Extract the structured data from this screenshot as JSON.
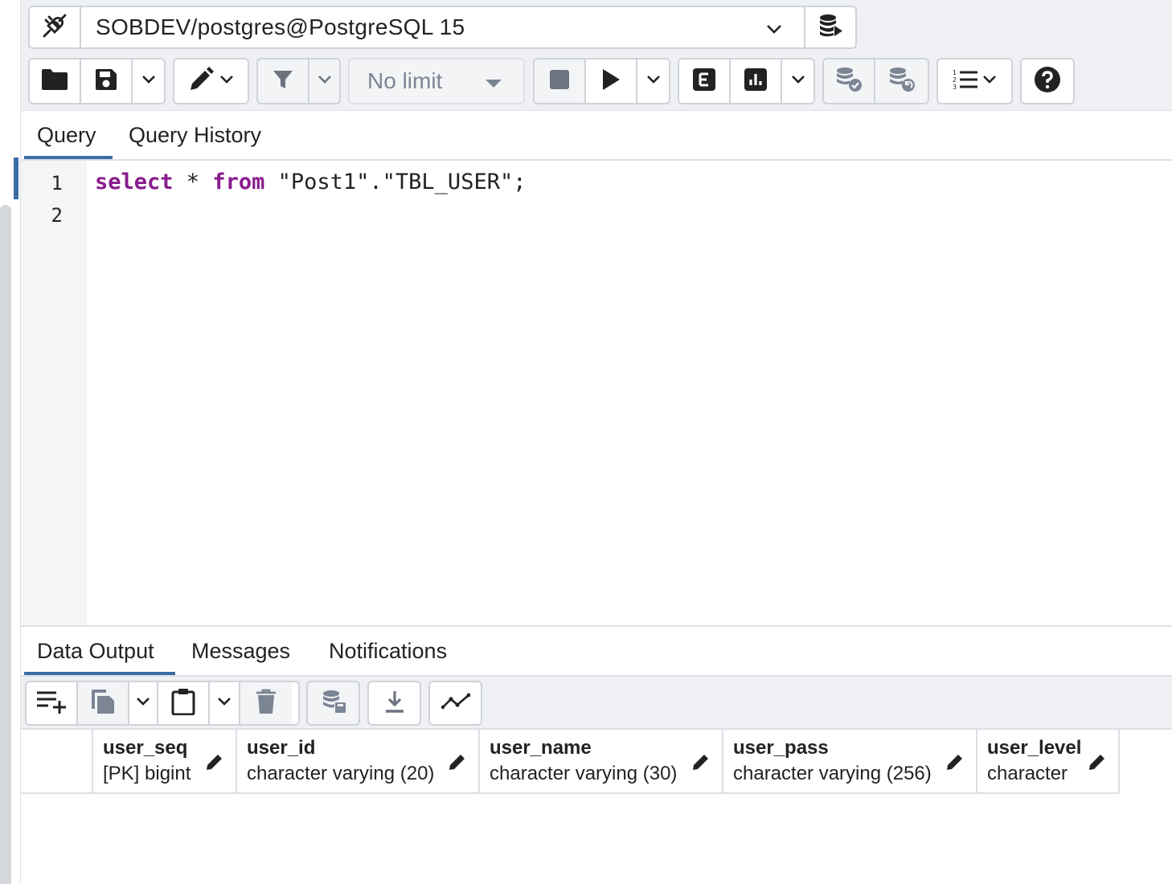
{
  "connection": {
    "label": "SOBDEV/postgres@PostgreSQL 15"
  },
  "toolbar": {
    "limit_label": "No limit"
  },
  "query_tabs": [
    {
      "label": "Query",
      "active": true
    },
    {
      "label": "Query History",
      "active": false
    }
  ],
  "editor": {
    "line_numbers": [
      "1",
      "2"
    ],
    "line1": {
      "kw_select": "select",
      "star": " * ",
      "kw_from": "from",
      "rest": " \"Post1\".\"TBL_USER\";"
    }
  },
  "output_tabs": [
    {
      "label": "Data Output",
      "active": true
    },
    {
      "label": "Messages",
      "active": false
    },
    {
      "label": "Notifications",
      "active": false
    }
  ],
  "grid": {
    "columns": [
      {
        "name": "user_seq",
        "type": "[PK] bigint"
      },
      {
        "name": "user_id",
        "type": "character varying (20)"
      },
      {
        "name": "user_name",
        "type": "character varying (30)"
      },
      {
        "name": "user_pass",
        "type": "character varying (256)"
      },
      {
        "name": "user_level",
        "type": "character"
      }
    ]
  },
  "colors": {
    "accent": "#3a6ea5",
    "keyword": "#8a1b8e",
    "toolbar_bg": "#eef0f3",
    "border": "#cfd3d9"
  },
  "icons": {
    "connection": "plug-disconnected-icon",
    "connection_action": "database-play-icon",
    "file": [
      "folder-open-icon",
      "save-icon",
      "chevron-down-icon"
    ],
    "edit": [
      "pencil-icon",
      "chevron-down-icon"
    ],
    "filter": [
      "filter-icon",
      "chevron-down-icon"
    ],
    "execute": [
      "stop-icon",
      "play-icon",
      "chevron-down-icon"
    ],
    "explain": [
      "explain-icon",
      "explain-analyze-icon",
      "chevron-down-icon"
    ],
    "transaction": [
      "commit-icon",
      "rollback-icon"
    ],
    "macros": "list-numbered-icon",
    "help": "help-icon",
    "output": [
      "add-row-icon",
      "copy-icon",
      "chevron-down-icon",
      "paste-icon",
      "chevron-down-icon",
      "delete-icon",
      "save-data-icon",
      "download-icon",
      "graph-icon"
    ]
  }
}
